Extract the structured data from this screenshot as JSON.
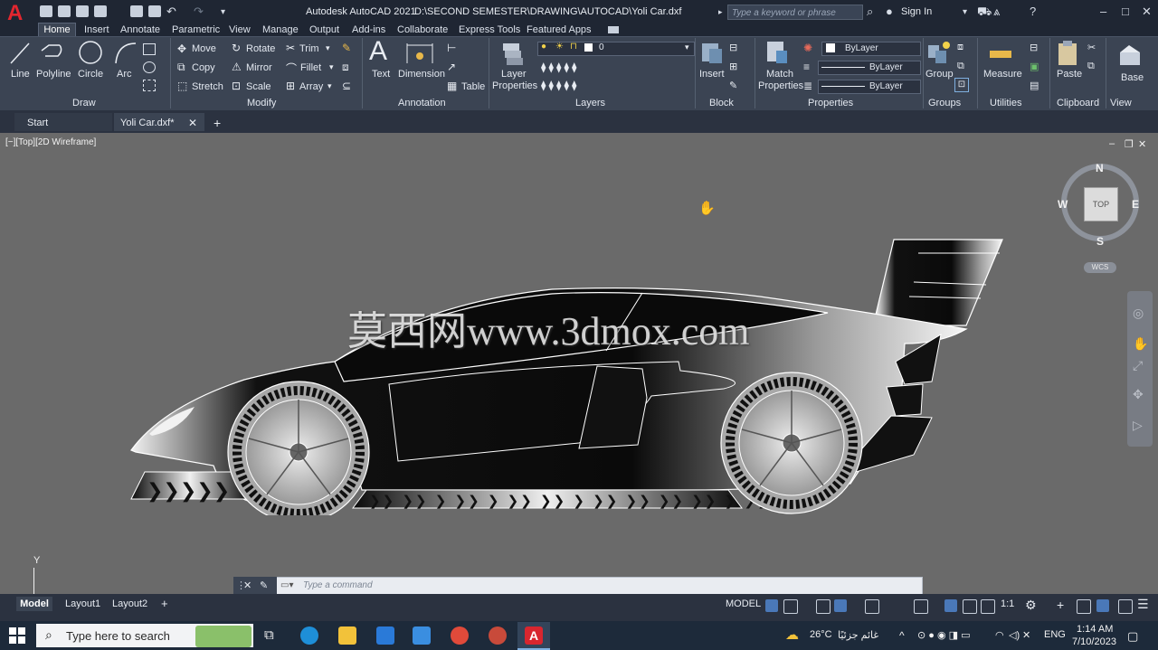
{
  "app": {
    "title": "Autodesk AutoCAD 2021",
    "file_path": "D:\\SECOND SEMESTER\\DRAWING\\AUTOCAD\\Yoli Car.dxf",
    "search_placeholder": "Type a keyword or phrase",
    "sign_in": "Sign In",
    "logo_letter": "A"
  },
  "menu": {
    "tabs": [
      "Home",
      "Insert",
      "Annotate",
      "Parametric",
      "View",
      "Manage",
      "Output",
      "Add-ins",
      "Collaborate",
      "Express Tools",
      "Featured Apps"
    ]
  },
  "ribbon": {
    "draw": {
      "line": "Line",
      "polyline": "Polyline",
      "circle": "Circle",
      "arc": "Arc",
      "title": "Draw"
    },
    "modify": {
      "move": "Move",
      "rotate": "Rotate",
      "trim": "Trim",
      "copy": "Copy",
      "mirror": "Mirror",
      "fillet": "Fillet",
      "stretch": "Stretch",
      "scale": "Scale",
      "array": "Array",
      "title": "Modify"
    },
    "annotation": {
      "text": "Text",
      "dimension": "Dimension",
      "table": "Table",
      "title": "Annotation"
    },
    "layers": {
      "layer_properties_1": "Layer",
      "layer_properties_2": "Properties",
      "current_layer": "0",
      "title": "Layers"
    },
    "block": {
      "insert": "Insert",
      "title": "Block"
    },
    "properties": {
      "match_1": "Match",
      "match_2": "Properties",
      "color": "ByLayer",
      "linetype": "ByLayer",
      "lineweight": "ByLayer",
      "title": "Properties"
    },
    "groups": {
      "group": "Group",
      "title": "Groups"
    },
    "utilities": {
      "measure": "Measure",
      "title": "Utilities"
    },
    "clipboard": {
      "paste": "Paste",
      "title": "Clipboard"
    },
    "view": {
      "base": "Base",
      "title": "View"
    }
  },
  "doc_tabs": {
    "start": "Start",
    "active": "Yoli Car.dxf*"
  },
  "viewport": {
    "label": "[−][Top][2D Wireframe]",
    "compass": {
      "n": "N",
      "s": "S",
      "e": "E",
      "w": "W",
      "top": "TOP",
      "wcs": "WCS"
    },
    "watermark": "莫西网www.3dmox.com",
    "ucs_y": "Y"
  },
  "command": {
    "placeholder": "Type a command"
  },
  "layouts": {
    "model": "Model",
    "layout1": "Layout1",
    "layout2": "Layout2"
  },
  "status": {
    "model": "MODEL",
    "scale": "1:1"
  },
  "taskbar": {
    "search": "Type here to search",
    "weather": "26°C",
    "weather_desc": "غائم جزئيًا",
    "lang": "ENG",
    "time": "1:14 AM",
    "date": "7/10/2023"
  },
  "colors": {
    "title_bg": "#1f2633",
    "ribbon_bg": "#3b4453",
    "viewport_bg": "#6a6a6a",
    "autocad_red": "#e3262f"
  }
}
